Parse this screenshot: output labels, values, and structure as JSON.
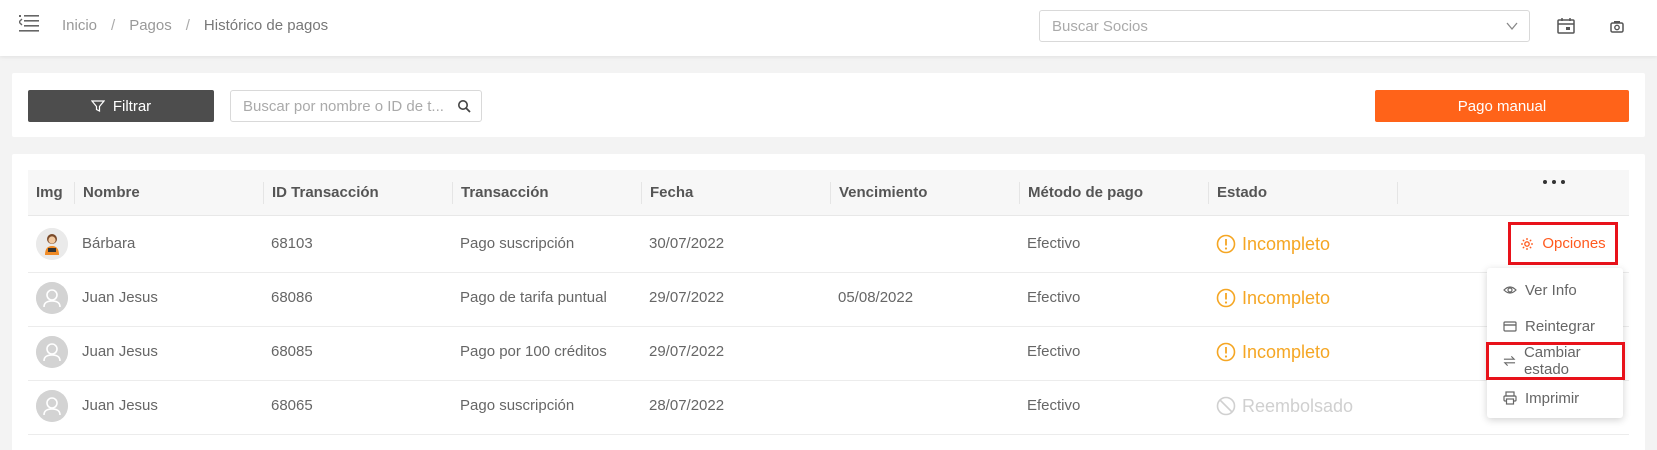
{
  "breadcrumb": {
    "home": "Inicio",
    "section": "Pagos",
    "current": "Histórico de pagos"
  },
  "header": {
    "member_search_placeholder": "Buscar Socios"
  },
  "toolbar": {
    "filter_label": "Filtrar",
    "search_placeholder": "Buscar por nombre o ID de t...",
    "manual_payment_label": "Pago manual"
  },
  "table": {
    "columns": [
      "Img",
      "Nombre",
      "ID Transacción",
      "Transacción",
      "Fecha",
      "Vencimiento",
      "Método de pago",
      "Estado"
    ],
    "rows": [
      {
        "name": "Bárbara",
        "id": "68103",
        "transaction": "Pago suscripción",
        "date": "30/07/2022",
        "due": "",
        "method": "Efectivo",
        "status": "Incompleto"
      },
      {
        "name": "Juan Jesus",
        "id": "68086",
        "transaction": "Pago de tarifa puntual",
        "date": "29/07/2022",
        "due": "05/08/2022",
        "method": "Efectivo",
        "status": "Incompleto"
      },
      {
        "name": "Juan Jesus",
        "id": "68085",
        "transaction": "Pago por 100 créditos",
        "date": "29/07/2022",
        "due": "",
        "method": "Efectivo",
        "status": "Incompleto"
      },
      {
        "name": "Juan Jesus",
        "id": "68065",
        "transaction": "Pago suscripción",
        "date": "28/07/2022",
        "due": "",
        "method": "Efectivo",
        "status": "Reembolsado"
      }
    ]
  },
  "row_actions": {
    "options_label": "Opciones",
    "menu": [
      "Ver Info",
      "Reintegrar",
      "Cambiar estado",
      "Imprimir"
    ]
  },
  "colors": {
    "accent": "#ff6319",
    "warning": "#f5a623",
    "highlight": "#e8121a",
    "dark_button": "#4d4d4d"
  }
}
